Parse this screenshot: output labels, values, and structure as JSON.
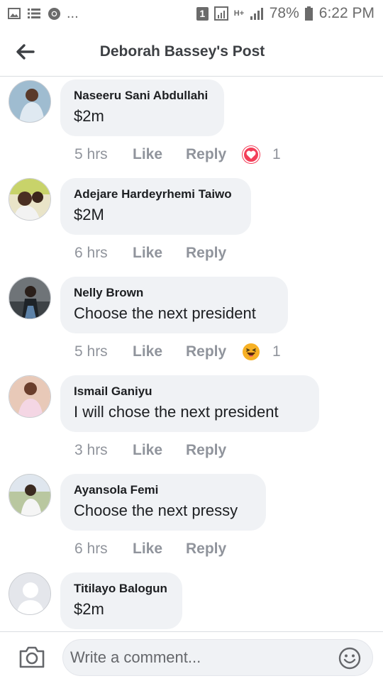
{
  "status_bar": {
    "left_icons": [
      "image-icon",
      "list-icon",
      "chrome-icon",
      "more-dots-icon"
    ],
    "dots": "...",
    "sim_badge": "1",
    "network": "H+",
    "battery": "78%",
    "time": "6:22 PM"
  },
  "header": {
    "title": "Deborah Bassey's Post",
    "back_icon": "back-arrow-icon"
  },
  "comments": [
    {
      "name": "Naseeru Sani Abdullahi",
      "text": "$2m",
      "time": "5 hrs",
      "like": "Like",
      "reply": "Reply",
      "reaction": "love",
      "reaction_count": "1"
    },
    {
      "name": "Adejare Hardeyrhemi Taiwo",
      "text": "$2M",
      "time": "6 hrs",
      "like": "Like",
      "reply": "Reply"
    },
    {
      "name": "Nelly Brown",
      "text": "Choose the next president",
      "time": "5 hrs",
      "like": "Like",
      "reply": "Reply",
      "reaction": "haha",
      "reaction_count": "1"
    },
    {
      "name": "Ismail Ganiyu",
      "text": "I will chose the next president",
      "time": "3 hrs",
      "like": "Like",
      "reply": "Reply"
    },
    {
      "name": "Ayansola Femi",
      "text": "Choose the next pressy",
      "time": "6 hrs",
      "like": "Like",
      "reply": "Reply"
    },
    {
      "name": "Titilayo Balogun",
      "text": "$2m"
    }
  ],
  "composer": {
    "placeholder": "Write a comment...",
    "camera_icon": "camera-icon",
    "emoji_icon": "emoji-icon"
  },
  "colors": {
    "bubble": "#f0f2f5",
    "action_text": "#90949c",
    "love": "#f33e58",
    "haha": "#f7b125"
  }
}
